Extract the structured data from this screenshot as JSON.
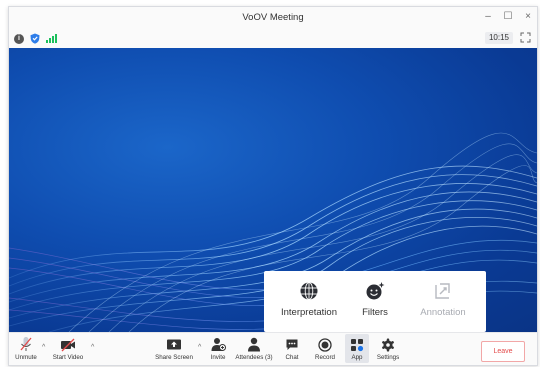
{
  "window": {
    "title": "VoOV Meeting"
  },
  "info_bar": {
    "time": "10:15",
    "icons": [
      "info-icon",
      "shield-icon",
      "signal-icon"
    ]
  },
  "popup": {
    "items": [
      {
        "label": "Interpretation",
        "icon": "globe-icon",
        "enabled": true
      },
      {
        "label": "Filters",
        "icon": "face-sparkle-icon",
        "enabled": true
      },
      {
        "label": "Annotation",
        "icon": "annotation-icon",
        "enabled": false
      }
    ]
  },
  "toolbar": {
    "unmute": "Unmute",
    "start_video": "Start Video",
    "share_screen": "Share Screen",
    "invite": "Invite",
    "attendees": "Attendees (3)",
    "chat": "Chat",
    "record": "Record",
    "app": "App",
    "settings": "Settings",
    "leave": "Leave"
  },
  "colors": {
    "accent_blue": "#1a73e8",
    "leave_red": "#e34a4a",
    "signal_green": "#1bbf5c",
    "video_bg": "#0f4db0"
  }
}
